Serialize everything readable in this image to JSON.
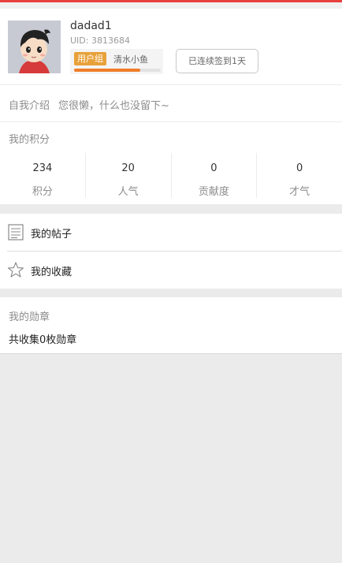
{
  "profile": {
    "username": "dadad1",
    "uid": "UID: 3813684",
    "group_badge": "用户组",
    "group_name": "清水小鱼",
    "group_progress": 0.76,
    "signin_label": "已连续签到1天"
  },
  "intro": {
    "label": "自我介绍",
    "text": "您很懒，什么也没留下~"
  },
  "points": {
    "title": "我的积分",
    "items": [
      {
        "value": "234",
        "label": "积分"
      },
      {
        "value": "20",
        "label": "人气"
      },
      {
        "value": "0",
        "label": "贡献度"
      },
      {
        "value": "0",
        "label": "才气"
      }
    ]
  },
  "menu": {
    "items": [
      {
        "label": "我的帖子",
        "icon": "document-icon"
      },
      {
        "label": "我的收藏",
        "icon": "star-icon"
      }
    ]
  },
  "medals": {
    "title": "我的勋章",
    "text": "共收集0枚勋章"
  },
  "colors": {
    "accent": "#e8403f",
    "badge": "#e8a13a",
    "progress": "#f07d2a"
  }
}
